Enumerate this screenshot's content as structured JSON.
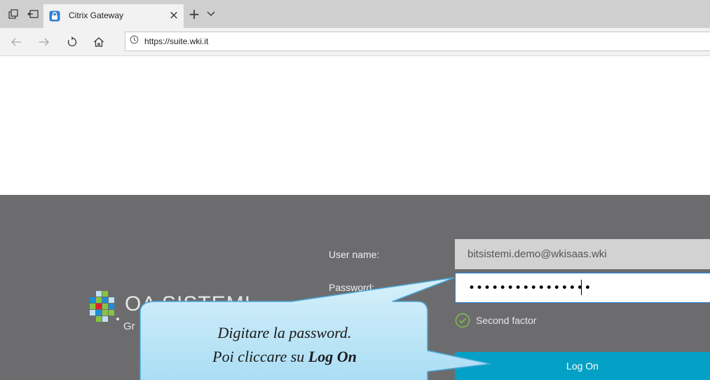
{
  "browser": {
    "tab": {
      "title": "Citrix Gateway",
      "close_glyph": "×",
      "favicon": "lock-icon"
    },
    "new_tab_glyph": "+",
    "tab_menu_glyph": "⌵",
    "url": "https://suite.wki.it"
  },
  "login": {
    "username_label": "User name:",
    "username_value": "bitsistemi.demo@wkisaas.wki",
    "password_label": "Password:",
    "password_masked": "••••••••••••••••",
    "second_factor_label": "Second factor",
    "logon_label": "Log On",
    "logo_text": "OA SISTEMI",
    "logo_subtext": "Gr"
  },
  "callout": {
    "line1": "Digitare la password.",
    "line2_prefix": "Poi cliccare su ",
    "line2_bold": "Log On"
  },
  "colors": {
    "page_background": "#6c6c6f",
    "logon_button": "#05a0c6",
    "callout_fill": "#bfe6f8",
    "callout_border": "#49a7d8",
    "focus_border": "#1e88e5",
    "second_factor_icon": "#7cc24a"
  }
}
